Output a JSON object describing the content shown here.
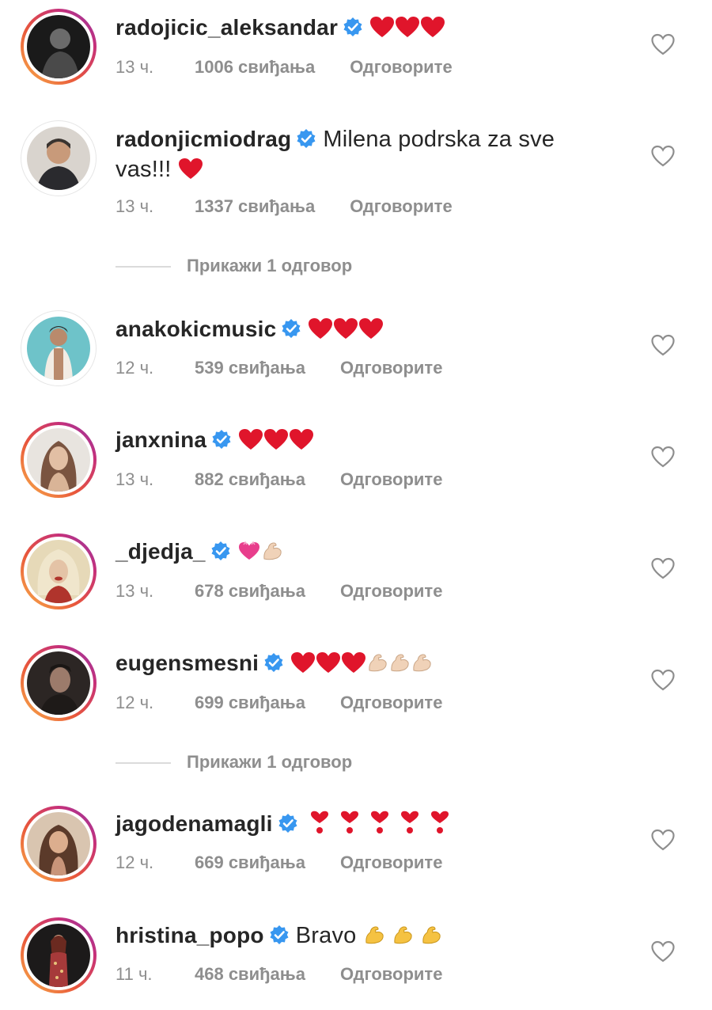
{
  "comments": [
    {
      "username": "radojicic_aleksandar",
      "text": "",
      "emojis": [
        "red-heart",
        "red-heart",
        "red-heart"
      ],
      "time": "13 ч.",
      "likes": "1006 свиђања",
      "reply": "Одговорите",
      "story_ring": true,
      "avatar_colors": [
        "#1a1a1a",
        "#6b6b6b"
      ]
    },
    {
      "username": "radonjicmiodrag",
      "text": "Milena podrska za sve",
      "text2": "vas!!!",
      "emojis": [
        "red-heart"
      ],
      "time": "13 ч.",
      "likes": "1337 свиђања",
      "reply": "Одговорите",
      "story_ring": false,
      "avatar_colors": [
        "#3a3430",
        "#c89a7a"
      ]
    },
    {
      "username": "anakokicmusic",
      "text": "",
      "emojis": [
        "red-heart",
        "red-heart",
        "red-heart"
      ],
      "time": "12 ч.",
      "likes": "539 свиђања",
      "reply": "Одговорите",
      "story_ring": false,
      "avatar_colors": [
        "#6ec3c9",
        "#e9d8c9"
      ]
    },
    {
      "username": "janxnina",
      "text": "",
      "emojis": [
        "red-heart",
        "red-heart",
        "red-heart"
      ],
      "time": "13 ч.",
      "likes": "882 свиђања",
      "reply": "Одговорите",
      "story_ring": true,
      "avatar_colors": [
        "#e8e4df",
        "#7a5440"
      ]
    },
    {
      "username": "_djedja_",
      "text": "",
      "emojis": [
        "pink-heart",
        "flexed-biceps"
      ],
      "time": "13 ч.",
      "likes": "678 свиђања",
      "reply": "Одговорите",
      "story_ring": true,
      "avatar_colors": [
        "#e6d9b8",
        "#b0342c"
      ]
    },
    {
      "username": "eugensmesni",
      "text": "",
      "emojis": [
        "red-heart",
        "red-heart",
        "red-heart",
        "flexed-biceps",
        "flexed-biceps",
        "flexed-biceps"
      ],
      "time": "12 ч.",
      "likes": "699 свиђања",
      "reply": "Одговорите",
      "story_ring": true,
      "avatar_colors": [
        "#2c2624",
        "#9c7b6b"
      ]
    },
    {
      "username": "jagodenamagli",
      "text": "",
      "emojis": [
        "heart-exclamation",
        "heart-exclamation",
        "heart-exclamation",
        "heart-exclamation",
        "heart-exclamation"
      ],
      "time": "12 ч.",
      "likes": "669 свиђања",
      "reply": "Одговорите",
      "story_ring": true,
      "avatar_colors": [
        "#d9c5b0",
        "#5b3a2a"
      ]
    },
    {
      "username": "hristina_popo",
      "text": "Bravo",
      "emojis": [
        "flexed-biceps-yellow",
        "flexed-biceps-yellow",
        "flexed-biceps-yellow"
      ],
      "time": "11 ч.",
      "likes": "468 свиђања",
      "reply": "Одговорите",
      "story_ring": true,
      "avatar_colors": [
        "#1c1a1a",
        "#a63a3a"
      ]
    }
  ],
  "view_replies": [
    "Прикажи 1 одговор",
    "Прикажи 1 одговор"
  ],
  "colors": {
    "text": "#262626",
    "meta": "#8e8e8e",
    "verified": "#3897f0",
    "heart": "#e0152b"
  },
  "icons": {
    "like": "heart-outline-icon",
    "verified": "verified-badge-icon"
  }
}
